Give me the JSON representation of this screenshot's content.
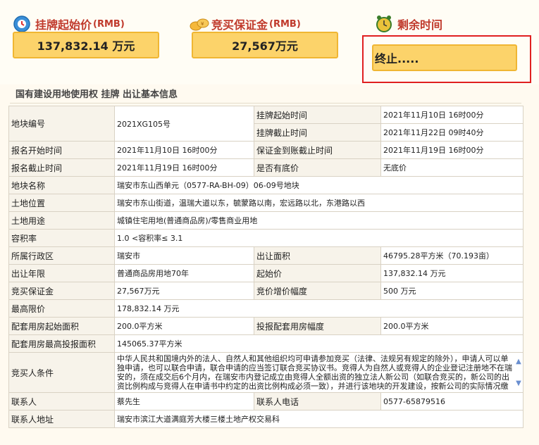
{
  "price_block": {
    "label": "挂牌起始价",
    "unit": "(RMB)",
    "value": "137,832.14 万元"
  },
  "deposit_block": {
    "label": "竞买保证金",
    "unit": "(RMB)",
    "value": "27,567万元"
  },
  "time_block": {
    "label": "剩余时间",
    "value": "终止....."
  },
  "section_title": "国有建设用地使用权 挂牌 出让基本信息",
  "rows": {
    "parcel_no_k": "地块编号",
    "parcel_no_v": "2021XG105号",
    "list_start_k": "挂牌起始时间",
    "list_start_v": "2021年11月10日 16时00分",
    "list_end_k": "挂牌截止时间",
    "list_end_v": "2021年11月22日 09时40分",
    "reg_start_k": "报名开始时间",
    "reg_start_v": "2021年11月10日 16时00分",
    "deposit_deadline_k": "保证金到账截止时间",
    "deposit_deadline_v": "2021年11月19日 16时00分",
    "reg_end_k": "报名截止时间",
    "reg_end_v": "2021年11月19日 16时00分",
    "reserve_k": "是否有底价",
    "reserve_v": "无底价",
    "name_k": "地块名称",
    "name_v": "瑞安市东山西单元（0577-RA-BH-09）06-09号地块",
    "location_k": "土地位置",
    "location_v": "瑞安市东山街道，温瑞大道以东，毓蒙路以南，宏远路以北，东港路以西",
    "use_k": "土地用途",
    "use_v": "城镇住宅用地(普通商品房)/零售商业用地",
    "far_k": "容积率",
    "far_v": "1.0 <容积率≤ 3.1",
    "district_k": "所属行政区",
    "district_v": "瑞安市",
    "area_k": "出让面积",
    "area_v": "46795.28平方米（70.193亩）",
    "term_k": "出让年限",
    "term_v": "普通商品房用地70年",
    "start_price_k": "起始价",
    "start_price_v": "137,832.14 万元",
    "bid_deposit_k": "竞买保证金",
    "bid_deposit_v": "27,567万元",
    "increment_k": "竞价增价幅度",
    "increment_v": "500 万元",
    "max_price_k": "最高限价",
    "max_price_v": "178,832.14 万元",
    "housing_base_k": "配套用房起始面积",
    "housing_base_v": "200.0平方米",
    "housing_step_k": "投报配套用房幅度",
    "housing_step_v": "200.0平方米",
    "housing_max_k": "配套用房最高投报面积",
    "housing_max_v": "145065.37平方米",
    "bidder_k": "竞买人条件",
    "bidder_v": "中华人民共和国境内外的法人、自然人和其他组织均可申请参加竞买（法律、法规另有规定的除外），申请人可以单独申请，也可以联合申请，联合申请的应当签订联合竞买协议书。竞得人为自然人或竞得人的企业登记注册地不在瑞安的，须在成交后6个月内，在瑞安市内登记成立由竞得人全额出资的独立法人新公司（如联合竞买的，新公司的出资比例构成与竞得人在申请书中约定的出资比例构成必须一致），并进行该地块的开发建设，按新公司的实际情况缴纳各项税费。",
    "contact_k": "联系人",
    "contact_v": "蔡先生",
    "phone_k": "联系人电话",
    "phone_v": "0577-65879516",
    "address_k": "联系人地址",
    "address_v": "瑞安市滨江大道满庭芳大楼三楼土地产权交易科"
  },
  "colors": {
    "accent_red": "#c0392b",
    "box_fill": "#fcd36a",
    "box_border": "#f0b633",
    "frame_red": "#e02020"
  }
}
